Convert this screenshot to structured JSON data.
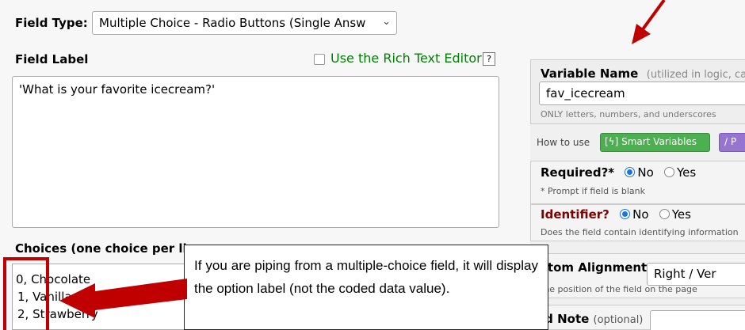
{
  "field_type": {
    "label": "Field Type:",
    "value": "Multiple Choice - Radio Buttons (Single Answ"
  },
  "field_label": {
    "label": "Field Label",
    "rich_text_label": "Use the Rich Text Editor",
    "help": "?",
    "value": "'What is your favorite icecream?'"
  },
  "choices": {
    "label": "Choices (one choice per lin",
    "items": [
      "0, Chocolate",
      "1, Vanilla",
      "2, Strawberry"
    ]
  },
  "variable_name": {
    "title": "Variable Name",
    "subtitle": "(utilized in logic, ca",
    "value": "fav_icecream",
    "help": "ONLY letters, numbers, and underscores"
  },
  "how_to_use": {
    "label": "How to use",
    "smart_variables": "[ϟ] Smart Variables",
    "piping": "∕ P"
  },
  "required": {
    "title": "Required?*",
    "no": "No",
    "yes": "Yes",
    "help": "* Prompt if field is blank"
  },
  "identifier": {
    "title": "Identifier?",
    "no": "No",
    "yes": "Yes",
    "help": "Does the field contain identifying information"
  },
  "alignment": {
    "title": "stom Alignment",
    "value": "Right / Ver",
    "help": "the position of the field on the page"
  },
  "field_note": {
    "title": "ld Note",
    "optional": "(optional)"
  },
  "callout": {
    "text": "If you are piping from a multiple-choice field, it will display the option label (not the coded data value)."
  },
  "colors": {
    "annotation_red": "#c00000",
    "rich_text_green": "#008000",
    "smart_var_green": "#4caf50",
    "identifier_red": "#800000",
    "piping_purple": "#9575cd"
  }
}
